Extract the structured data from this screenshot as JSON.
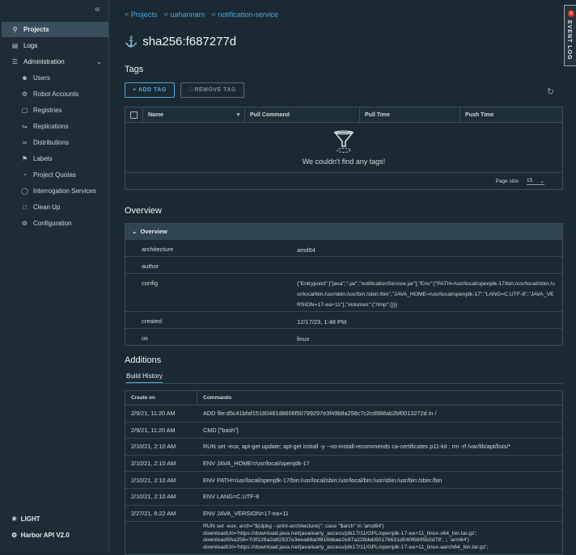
{
  "sidebar": {
    "items": [
      {
        "label": "Projects",
        "icon": "projects-icon"
      },
      {
        "label": "Logs",
        "icon": "logs-icon"
      },
      {
        "label": "Administration",
        "icon": "administration-icon"
      },
      {
        "label": "Users",
        "icon": "users-icon"
      },
      {
        "label": "Robot Accounts",
        "icon": "robot-icon"
      },
      {
        "label": "Registries",
        "icon": "registries-icon"
      },
      {
        "label": "Replications",
        "icon": "replications-icon"
      },
      {
        "label": "Distributions",
        "icon": "distributions-icon"
      },
      {
        "label": "Labels",
        "icon": "labels-icon"
      },
      {
        "label": "Project Quotas",
        "icon": "quotas-icon"
      },
      {
        "label": "Interrogation Services",
        "icon": "shield-icon"
      },
      {
        "label": "Clean Up",
        "icon": "trash-icon"
      },
      {
        "label": "Configuration",
        "icon": "gear-icon"
      }
    ],
    "theme_label": "LIGHT",
    "api_label": "Harbor API V2.0"
  },
  "breadcrumb": [
    "< Projects",
    "< uahannam",
    "< notification-service"
  ],
  "title": "sha256:f687277d",
  "tags": {
    "heading": "Tags",
    "add_label": "+ ADD TAG",
    "remove_label": "REMOVE TAG",
    "columns": [
      "Name",
      "Pull Command",
      "Pull Time",
      "Push Time"
    ],
    "empty_message": "We couldn't find any tags!",
    "page_size_label": "Page size",
    "page_size": "15"
  },
  "overview": {
    "heading": "Overview",
    "panel_title": "Overview",
    "rows": [
      {
        "key": "architecture",
        "value": "amd64"
      },
      {
        "key": "author",
        "value": ""
      },
      {
        "key": "config",
        "value": "{\"Entrypoint\":[\"java\",\"-jar\",\"notificationService.jar\"],\"Env\":[\"PATH=/usr/local/openjdk-17/bin:/usr/local/sbin:/usr/local/bin:/usr/sbin:/usr/bin:/sbin:/bin\",\"JAVA_HOME=/usr/local/openjdk-17\",\"LANG=C.UTF-8\",\"JAVA_VERSION=17-ea+11\"],\"Volumes\":{\"/tmp\":{}}}"
      },
      {
        "key": "created",
        "value": "12/17/23, 1:48 PM"
      },
      {
        "key": "os",
        "value": "linux"
      }
    ]
  },
  "additions": {
    "heading": "Additions",
    "tab": "Build History",
    "columns": [
      "Create on",
      "Commands"
    ],
    "rows": [
      {
        "date": "2/9/21, 11:20 AM",
        "cmd": "ADD file:d5c41bfaf15180481d8606f50799297e3f49b8a258c7c2cd988ab2bf0013272d in /"
      },
      {
        "date": "2/9/21, 11:20 AM",
        "cmd": "CMD [\"bash\"]"
      },
      {
        "date": "2/10/21, 2:10 AM",
        "cmd": "RUN set -eux; apt-get update; apt-get install -y --no-install-recommends ca-certificates p11-kit ; rm -rf /var/lib/apt/lists/*"
      },
      {
        "date": "2/10/21, 2:10 AM",
        "cmd": "ENV JAVA_HOME=/usr/local/openjdk-17"
      },
      {
        "date": "2/10/21, 2:10 AM",
        "cmd": "ENV PATH=/usr/local/openjdk-17/bin:/usr/local/sbin:/usr/local/bin:/usr/sbin:/usr/bin:/sbin:/bin"
      },
      {
        "date": "2/10/21, 2:10 AM",
        "cmd": "ENV LANG=C.UTF-8"
      },
      {
        "date": "2/27/21, 6:22 AM",
        "cmd": "ENV JAVA_VERSION=17-ea+11"
      }
    ],
    "last_cmd_lines": [
      "RUN set -eux; arch=\"$(dpkg --print-architecture)\"; case \"$arch\" in 'amd64')",
      "downloadUrl='https://download.java.net/java/early_access/jdk17/11/GPL/openjdk-17-ea+11_linux-x64_bin.tar.gz';",
      "downloadSha256='03f129a2a92537e3eea68a0f816bbae2e97a228deb50176631d040f6895b3d78'; ;; 'arm64')",
      "downloadUrl='https://download.java.net/java/early_access/jdk17/11/GPL/openjdk-17-ea+11_linux-aarch64_bin.tar.gz';"
    ]
  },
  "event_log": {
    "label": "EVENT LOG",
    "count": "0"
  }
}
